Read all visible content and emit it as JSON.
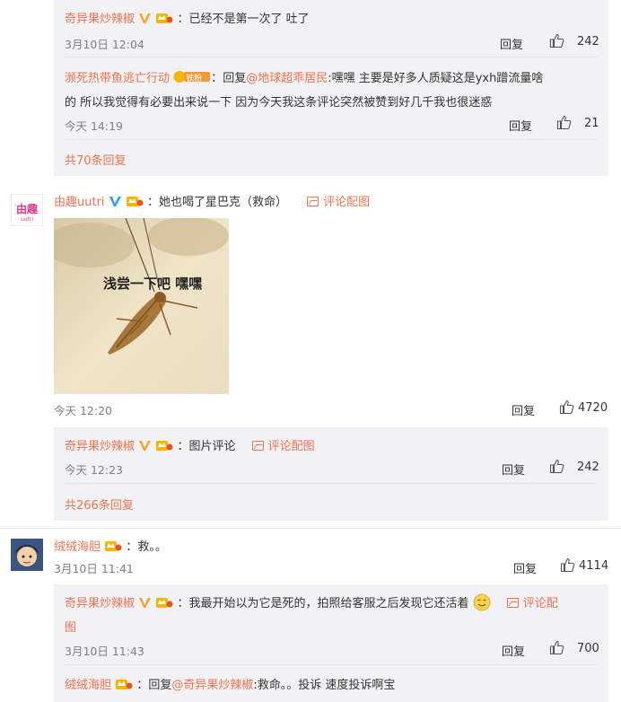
{
  "block1": {
    "reply1": {
      "name": "奇异果炒辣椒",
      "sep": "：",
      "text": "已经不是第一次了 吐了",
      "time": "3月10日 12:04",
      "reply_label": "回复",
      "likes": "242"
    },
    "reply2": {
      "name": "濒死热带鱼逃亡行动",
      "fan_badge": "铁粉",
      "sep": "：",
      "reply_prefix": "回复",
      "mention": "@地球超乖居民",
      "text_line1": ":嘿嘿 主要是好多人质疑这是yxh蹭流量啥",
      "text_line2": "的 所以我觉得有必要出来说一下 因为今天我这条评论突然被赞到好几千我也很迷惑",
      "time": "今天 14:19",
      "reply_label": "回复",
      "likes": "21"
    },
    "more": "共70条回复"
  },
  "comment2": {
    "avatar_text": "由趣",
    "avatar_sub": "uutri",
    "name": "由趣uutri",
    "sep": "：",
    "text": "她也喝了星巴克（救命）",
    "img_comment": "评论配图",
    "image_caption": "浅尝一下吧 嘿嘿",
    "time": "今天 12:20",
    "reply_label": "回复",
    "likes": "4720",
    "sub": {
      "name": "奇异果炒辣椒",
      "sep": "：",
      "text": "图片评论",
      "img_comment": "评论配图",
      "time": "今天 12:23",
      "reply_label": "回复",
      "likes": "242",
      "more": "共266条回复"
    }
  },
  "comment3": {
    "name": "绒绒海胆",
    "sep": "：",
    "text": "救。。",
    "time": "3月10日 11:41",
    "reply_label": "回复",
    "likes": "4114",
    "sub1": {
      "name": "奇异果炒辣椒",
      "sep": "：",
      "text": "我最开始以为它是死的，拍照给客服之后发现它还活着",
      "img_comment_a": "评论配",
      "img_comment_b": "图",
      "time": "3月10日 11:43",
      "reply_label": "回复",
      "likes": "700"
    },
    "sub2": {
      "name": "绒绒海胆",
      "sep": "：",
      "reply_prefix": "回复",
      "mention": "@奇异果炒辣椒",
      "text": ":救命。。投诉 速度投诉啊宝"
    }
  },
  "colors": {
    "accent": "#eb7350",
    "vip_blue": "#1da1f2",
    "sub_bg": "#f2f2f5"
  },
  "icons": [
    "verified-v-icon",
    "member-crown-icon",
    "fan-badge-icon",
    "thumb-up-icon",
    "picture-icon",
    "smile-emoji-icon"
  ]
}
